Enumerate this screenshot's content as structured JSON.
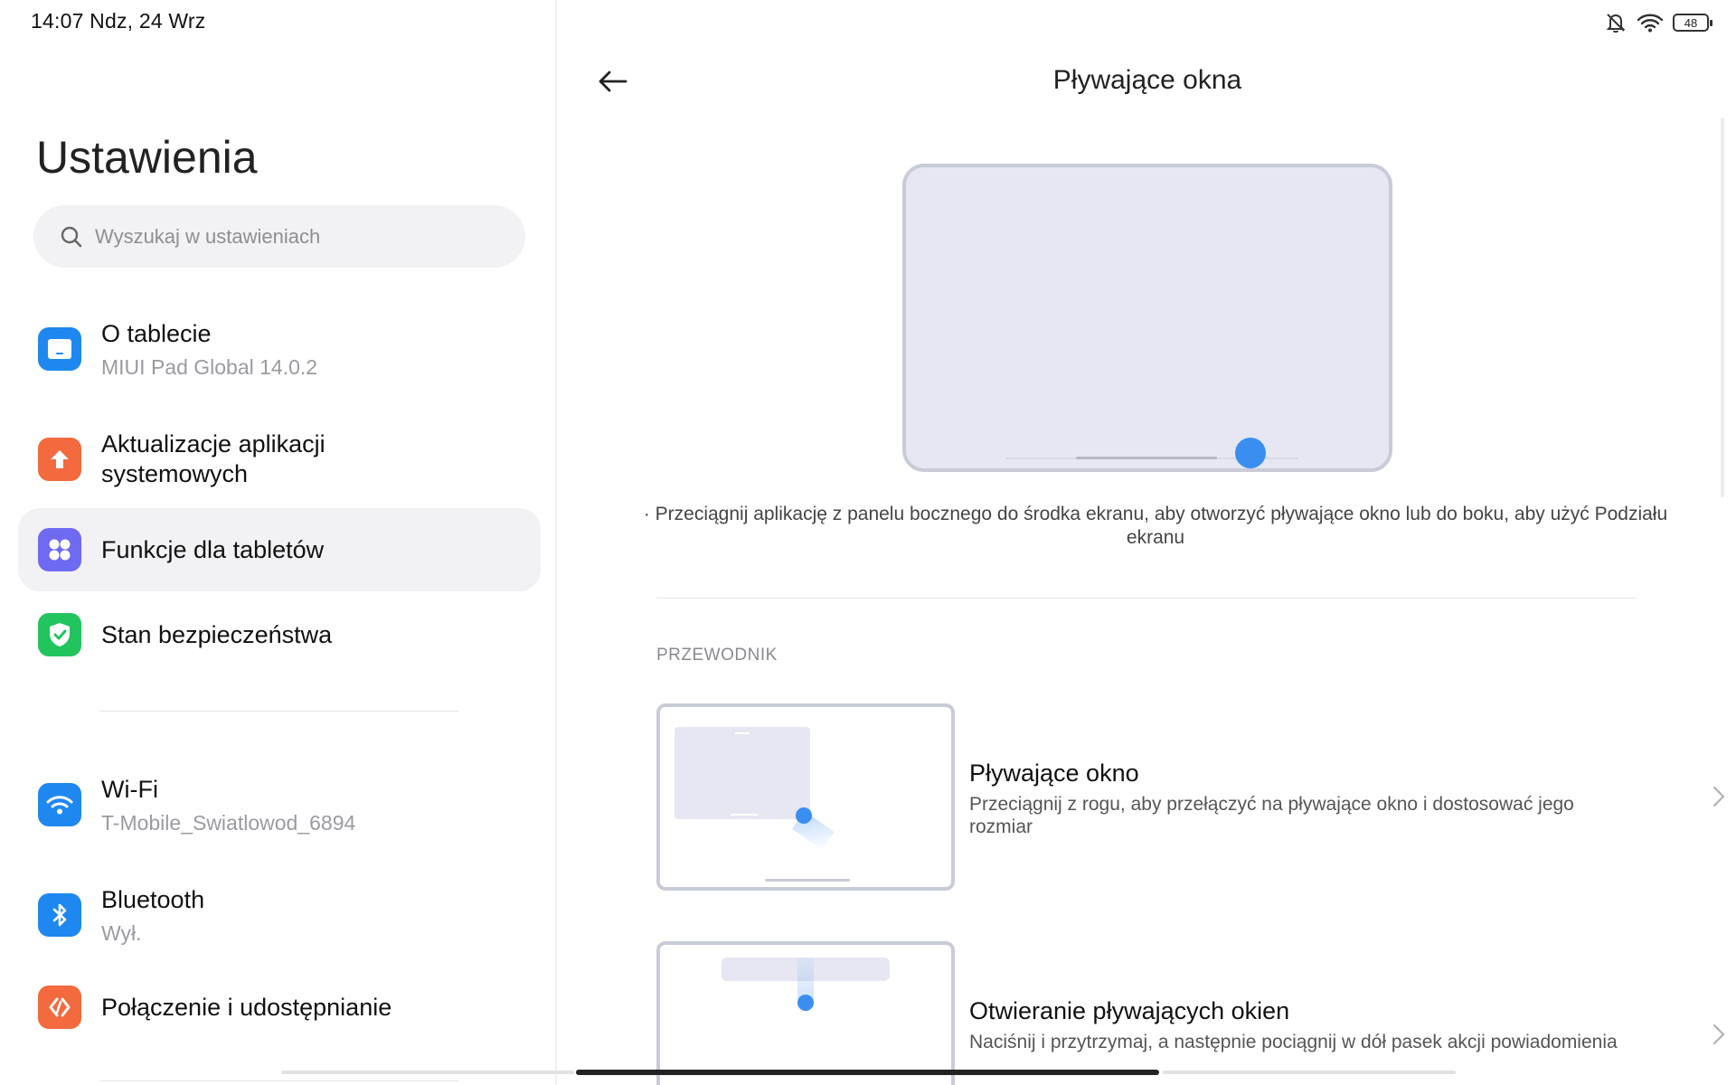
{
  "status_bar": {
    "time_date": "14:07 Ndz, 24 Wrz",
    "battery": "48"
  },
  "sidebar": {
    "title": "Ustawienia",
    "search_placeholder": "Wyszukaj w ustawieniach",
    "items": [
      {
        "label": "O tablecie",
        "sub": "MIUI Pad Global 14.0.2",
        "icon": "tablet-icon",
        "color": "#1e88f0"
      },
      {
        "label": "Aktualizacje aplikacji",
        "label2": "systemowych",
        "icon": "update-arrow-icon",
        "color": "#f26a3d"
      },
      {
        "label": "Funkcje dla tabletów",
        "icon": "grid-dots-icon",
        "color": "#6f6af2",
        "active": true
      },
      {
        "label": "Stan bezpieczeństwa",
        "icon": "shield-check-icon",
        "color": "#22c45e"
      },
      {
        "label": "Wi-Fi",
        "sub": "T-Mobile_Swiatlowod_6894",
        "icon": "wifi-icon",
        "color": "#1e88f0"
      },
      {
        "label": "Bluetooth",
        "sub": "Wył.",
        "icon": "bluetooth-icon",
        "color": "#1e88f0"
      },
      {
        "label": "Połączenie i udostępnianie",
        "icon": "connection-icon",
        "color": "#f26a3d"
      }
    ]
  },
  "main": {
    "title": "Pływające okna",
    "description": "· Przeciągnij aplikację z panelu bocznego do środka ekranu, aby otworzyć pływające okno lub do boku, aby użyć Podziału ekranu",
    "section_label": "PRZEWODNIK",
    "guides": [
      {
        "title": "Pływające okno",
        "subtitle": "Przeciągnij z rogu, aby przełączyć na pływające okno i dostosować jego rozmiar"
      },
      {
        "title": "Otwieranie pływających okien",
        "subtitle": "Naciśnij i przytrzymaj, a następnie pociągnij w dół pasek akcji powiadomienia"
      }
    ]
  },
  "colors": {
    "accent": "#3a8ef0",
    "active_bg": "#f2f2f4"
  }
}
